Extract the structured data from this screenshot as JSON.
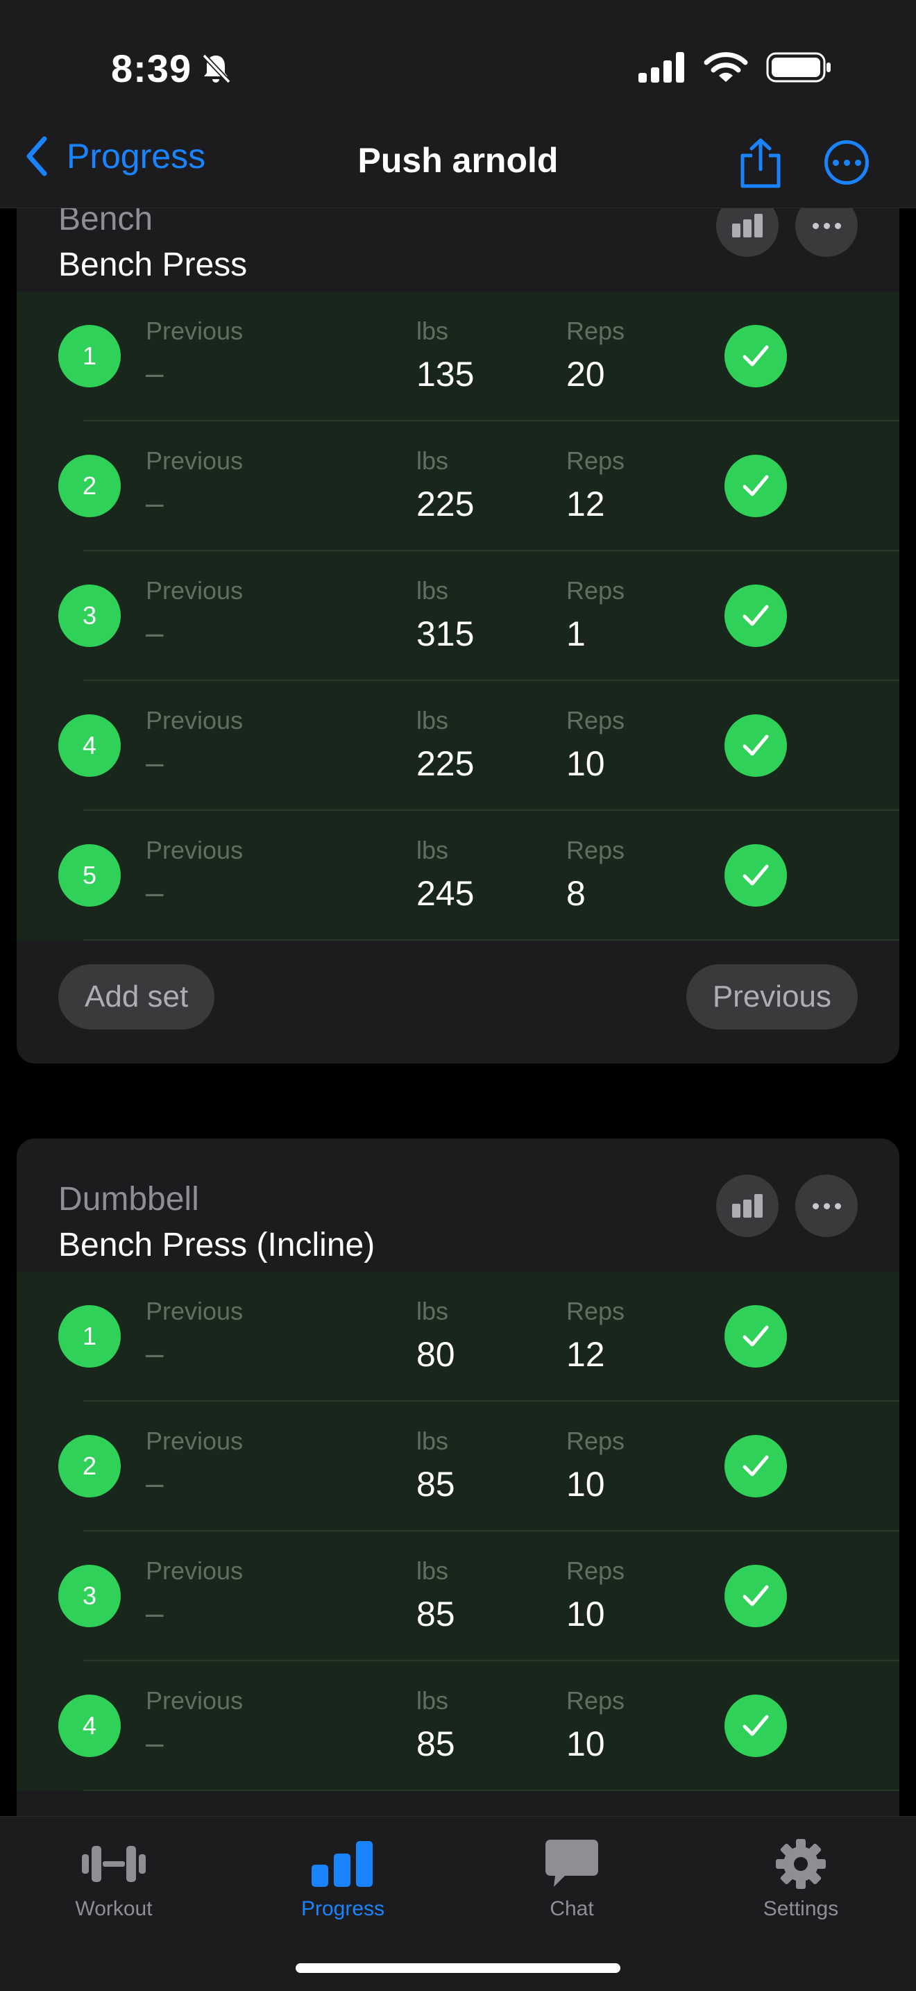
{
  "status_bar": {
    "time": "8:39"
  },
  "nav": {
    "back_label": "Progress",
    "title": "Push arnold"
  },
  "set_labels": {
    "previous": "Previous",
    "lbs": "lbs",
    "reps": "Reps"
  },
  "exercises": [
    {
      "category": "Bench",
      "name": "Bench Press",
      "sets": [
        {
          "num": "1",
          "previous": "–",
          "lbs": "135",
          "reps": "20"
        },
        {
          "num": "2",
          "previous": "–",
          "lbs": "225",
          "reps": "12"
        },
        {
          "num": "3",
          "previous": "–",
          "lbs": "315",
          "reps": "1"
        },
        {
          "num": "4",
          "previous": "–",
          "lbs": "225",
          "reps": "10"
        },
        {
          "num": "5",
          "previous": "–",
          "lbs": "245",
          "reps": "8"
        }
      ],
      "add_set_label": "Add set",
      "previous_button_label": "Previous"
    },
    {
      "category": "Dumbbell",
      "name": "Bench Press (Incline)",
      "sets": [
        {
          "num": "1",
          "previous": "–",
          "lbs": "80",
          "reps": "12"
        },
        {
          "num": "2",
          "previous": "–",
          "lbs": "85",
          "reps": "10"
        },
        {
          "num": "3",
          "previous": "–",
          "lbs": "85",
          "reps": "10"
        },
        {
          "num": "4",
          "previous": "–",
          "lbs": "85",
          "reps": "10"
        }
      ]
    }
  ],
  "tabs": [
    {
      "label": "Workout",
      "icon": "dumbbell-icon"
    },
    {
      "label": "Progress",
      "icon": "bar-chart-icon",
      "active": true
    },
    {
      "label": "Chat",
      "icon": "chat-bubble-icon"
    },
    {
      "label": "Settings",
      "icon": "gear-icon"
    }
  ],
  "colors": {
    "accent": "#1a84ff",
    "complete": "#30d158",
    "set_row_bg": "#18261b"
  }
}
